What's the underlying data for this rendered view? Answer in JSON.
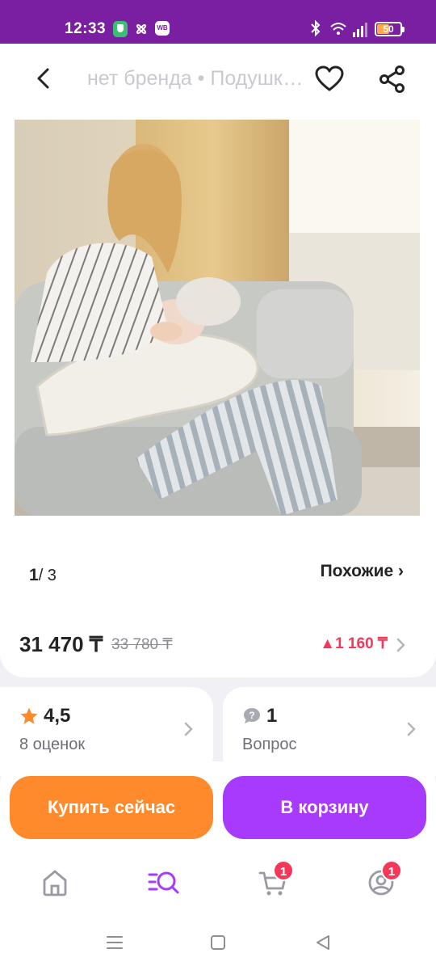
{
  "status_bar": {
    "time": "12:33",
    "wb_badge": "WB",
    "battery_percent": "50",
    "battery_level": 0.5
  },
  "header": {
    "title": "нет бренда • Подушка для кормления",
    "icons": [
      "back-arrow-icon",
      "heart-icon",
      "share-icon"
    ]
  },
  "gallery": {
    "current": "1",
    "total": "/ 3",
    "similar_label": "Похожие ›"
  },
  "price": {
    "current": "31 470 ₸",
    "old": "33 780 ₸",
    "drop": "▲1 160 ₸"
  },
  "rating": {
    "value": "4,5",
    "label": "8 оценок"
  },
  "questions": {
    "value": "1",
    "label": "Вопрос"
  },
  "actions": {
    "buy_now": "Купить сейчас",
    "add_to_cart": "В корзину"
  },
  "bottom_nav": {
    "items": [
      {
        "name": "home",
        "icon": "home-icon"
      },
      {
        "name": "catalog",
        "icon": "catalog-search-icon"
      },
      {
        "name": "cart",
        "icon": "cart-icon",
        "badge": "1"
      },
      {
        "name": "profile",
        "icon": "profile-icon",
        "badge": "1"
      }
    ]
  },
  "colors": {
    "status_bar": "#7b1fa2",
    "buy_now": "#ff8a2b",
    "add_to_cart": "#a73afd",
    "badge": "#f5385a",
    "price_drop": "#f5385a",
    "rating_star": "#ff8a2b",
    "catalog_active": "#a73afd"
  }
}
